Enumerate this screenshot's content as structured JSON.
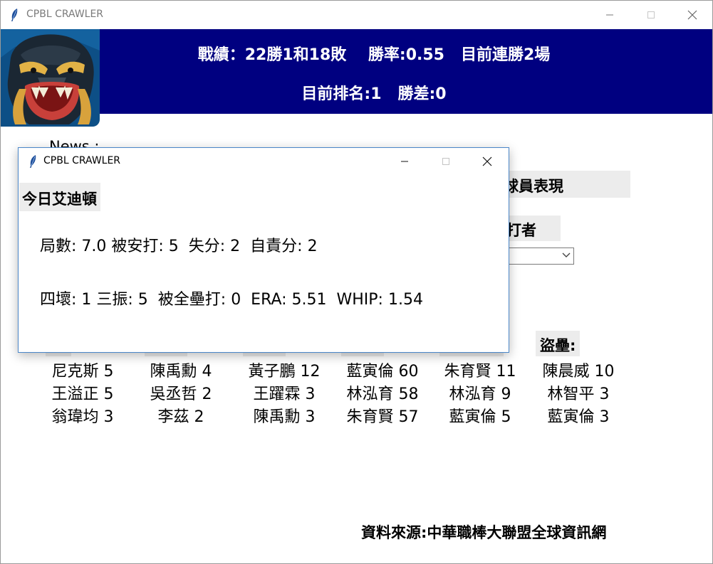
{
  "window": {
    "title": "CPBL CRAWLER",
    "icon": "feather-icon"
  },
  "banner": {
    "record_line": "戰績：22勝1和18敗    勝率:0.55   目前連勝2場",
    "rank_line": "目前排名:1   勝差:0",
    "bg_color": "#000080"
  },
  "main": {
    "news_label": "News :",
    "player_button_label": "球員表現",
    "batter_button_label": "打者",
    "combo_value": "",
    "steal_header": "盜壘:",
    "columns": [
      [
        "尼克斯 5",
        "王溢正 5",
        "翁瑋均 3"
      ],
      [
        "陳禹勳 4",
        "吳丞哲 2",
        "李茲 2"
      ],
      [
        "黃子鵬 12",
        "王躍霖 3",
        "陳禹勳 3"
      ],
      [
        "藍寅倫 60",
        "林泓育 58",
        "朱育賢 57"
      ],
      [
        "朱育賢 11",
        "林泓育 9",
        "藍寅倫 5"
      ],
      [
        "陳晨威 10",
        "林智平 3",
        "藍寅倫 3"
      ]
    ],
    "source": "資料來源:中華職棒大聯盟全球資訊網"
  },
  "popup": {
    "title": "CPBL CRAWLER",
    "today_label": "今日艾迪頓",
    "line1": "局數: 7.0 被安打: 5  失分: 2  自責分: 2",
    "line2": "四壞: 1 三振: 5  被全壘打: 0  ERA: 5.51  WHIP: 1.54"
  }
}
